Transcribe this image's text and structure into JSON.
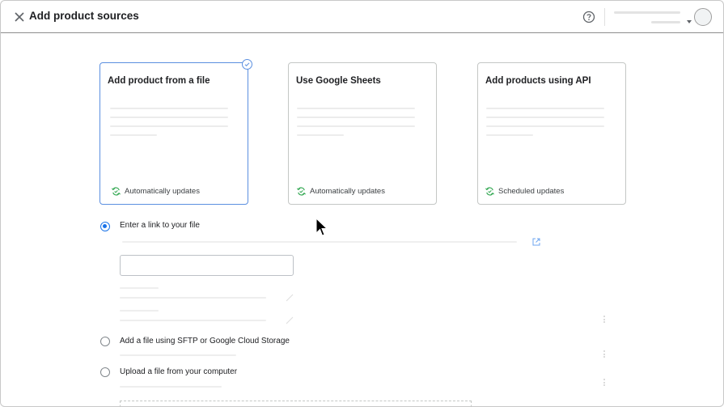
{
  "header": {
    "title": "Add product sources",
    "close_icon": "close-icon",
    "help_icon": "help-circle-icon"
  },
  "cards": [
    {
      "title": "Add product from a file",
      "footer": "Automatically updates",
      "selected": true
    },
    {
      "title": "Use Google Sheets",
      "footer": "Automatically updates",
      "selected": false
    },
    {
      "title": "Add products using API",
      "footer": "Scheduled updates",
      "selected": false
    }
  ],
  "options": [
    {
      "label": "Enter a link to your file",
      "checked": true
    },
    {
      "label": "Add a file using SFTP or Google Cloud Storage",
      "checked": false
    },
    {
      "label": "Upload a file from your computer",
      "checked": false
    }
  ],
  "link_input": {
    "value": ""
  },
  "colors": {
    "accent": "#1a73e8",
    "selected_border": "#5b8fe0",
    "sync_icon": "#34a853"
  }
}
